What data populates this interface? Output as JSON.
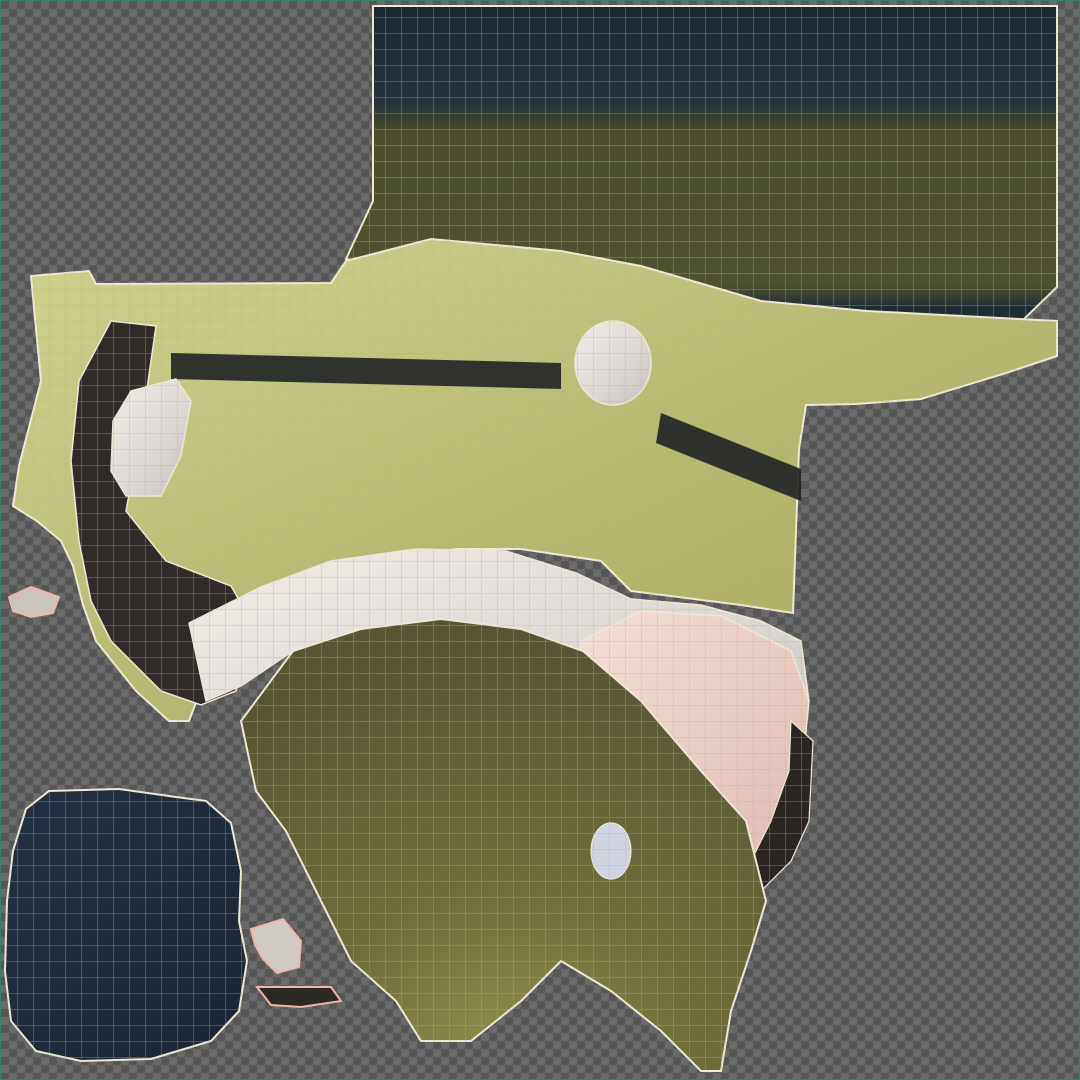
{
  "viewer": {
    "type": "uv-texture-editor",
    "background_pattern": "checkerboard",
    "colors": {
      "checker_dark": "#5a5a5a",
      "checker_light": "#6a6a6a",
      "viewport_border": "#3a7f6a",
      "wire": "#5fb0d6",
      "island_outline": "#f3ecd6",
      "selected_outline": "#f0b5a8"
    }
  },
  "texture_regions": [
    {
      "name": "dark-band",
      "color": "#24313a"
    },
    {
      "name": "olive-band",
      "color": "#4b4f2d"
    },
    {
      "name": "pale-yellow-green",
      "color": "#c7cc84"
    },
    {
      "name": "yellow-green",
      "color": "#a6a85c"
    },
    {
      "name": "dark-brown-strip",
      "color": "#2f2a27"
    },
    {
      "name": "cream-white",
      "color": "#e9e2d6"
    },
    {
      "name": "skin-pink",
      "color": "#e6cbc1"
    },
    {
      "name": "olive-green",
      "color": "#62652f"
    },
    {
      "name": "navy-panel",
      "color": "#243040"
    }
  ]
}
